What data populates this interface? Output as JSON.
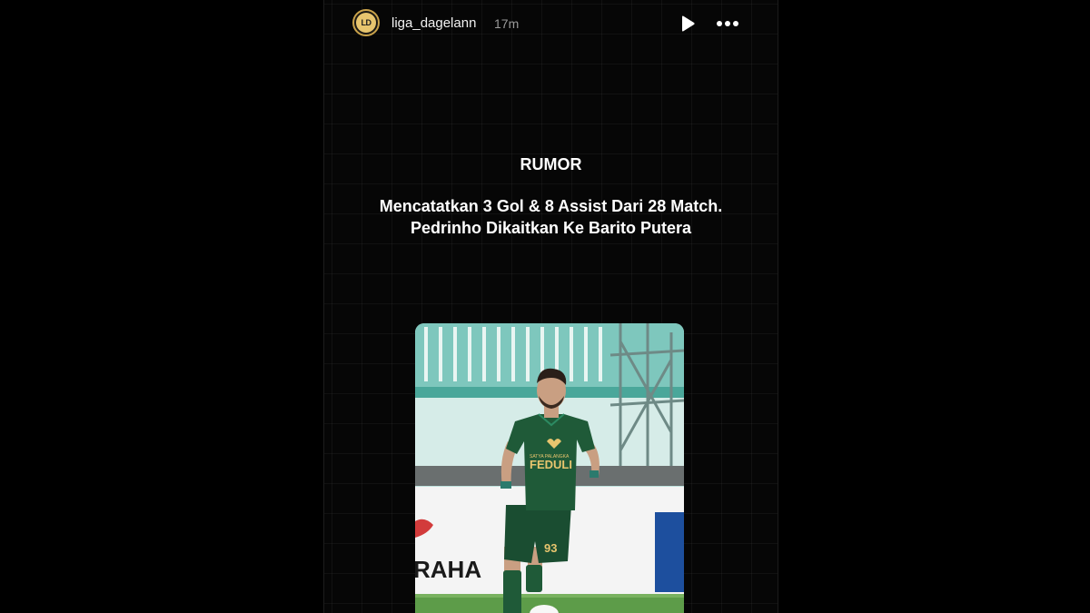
{
  "story": {
    "username": "liga_dagelann",
    "time": "17m",
    "avatar_text": "LD",
    "headline": {
      "tag": "RUMOR",
      "line1": "Mencatatkan 3 Gol & 8 Assist Dari 28 Match.",
      "line2": "Pedrinho Dikaitkan Ke Barito Putera"
    },
    "photo": {
      "jersey_text": "FEDULI",
      "jersey_small_text": "SATYA PALANGKA",
      "shorts_number": "93",
      "board_text": "RAHA"
    }
  },
  "icons": {
    "play": "play-icon",
    "more": "more-horizontal-icon"
  },
  "colors": {
    "background": "#000000",
    "story_bg": "#060606",
    "accent_gold": "#c9a24a",
    "jersey_green": "#1f5a38",
    "text_primary": "#ffffff",
    "text_muted": "#9a9a9a"
  }
}
